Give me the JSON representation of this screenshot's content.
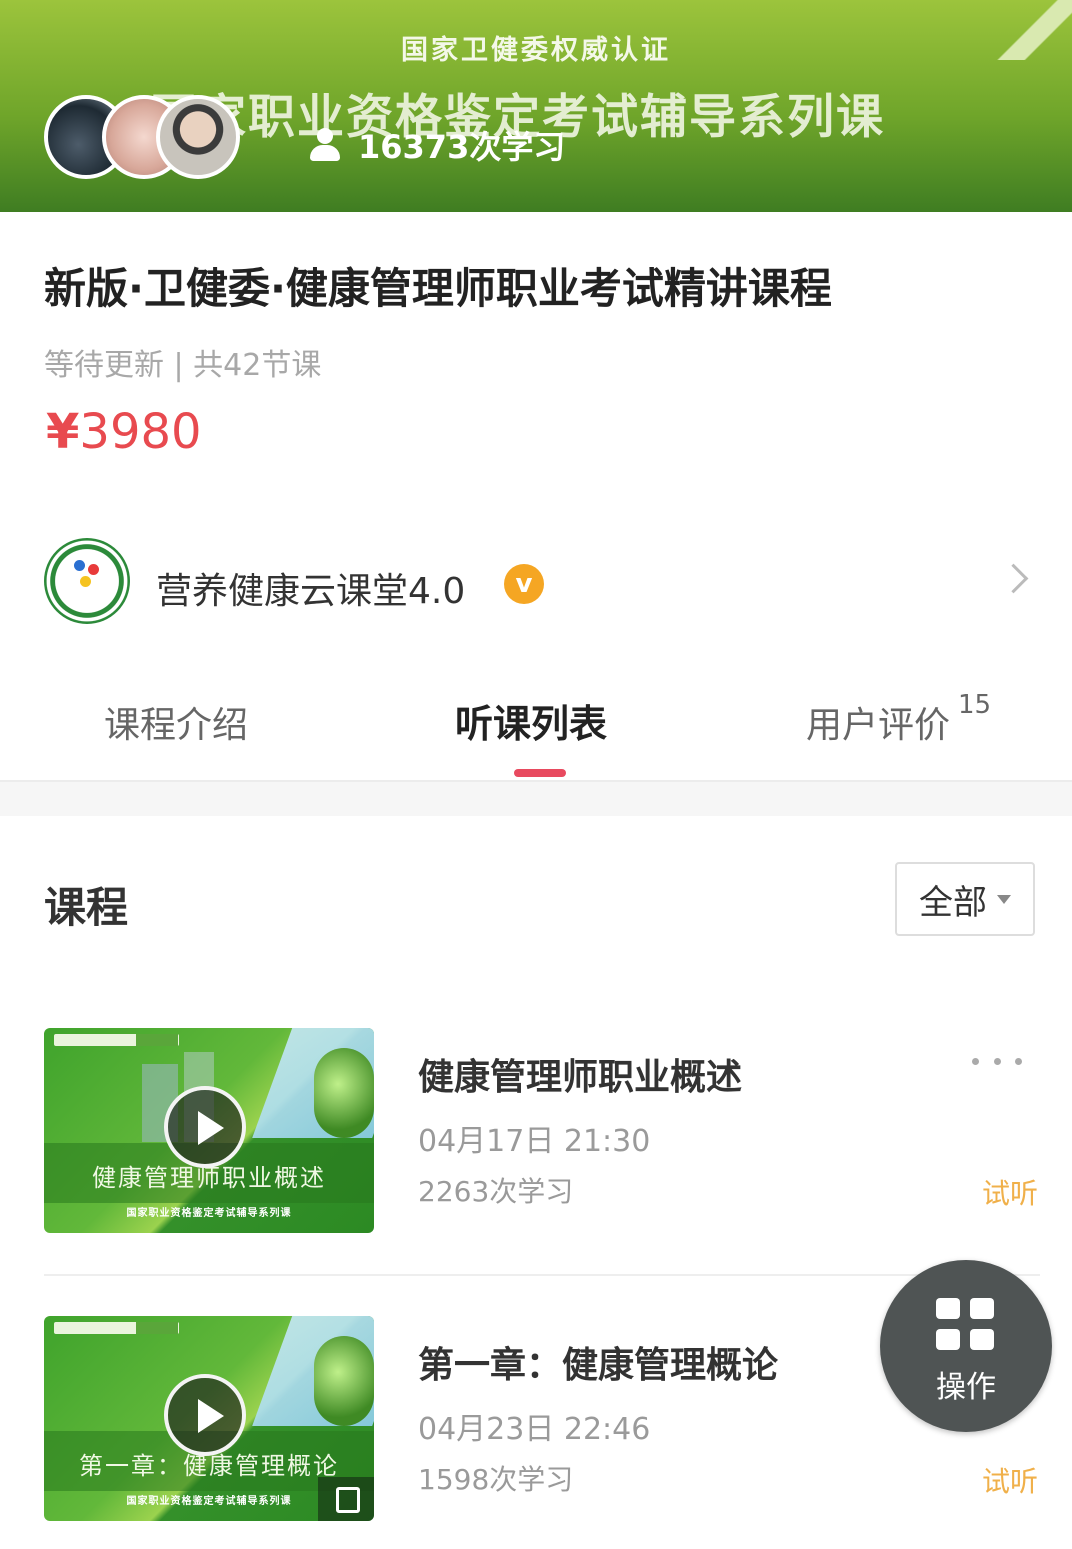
{
  "banner": {
    "top_text": "国家卫健委权威认证",
    "main_text": "国家职业资格鉴定考试辅导系列课",
    "learners": "16373次学习"
  },
  "course": {
    "title": "新版·卫健委·健康管理师职业考试精讲课程",
    "meta": "等待更新 | 共42节课",
    "price_symbol": "¥",
    "price_value": "3980",
    "price_color": "#e84a4f"
  },
  "org": {
    "name": "营养健康云课堂4.0",
    "verified_mark": "v"
  },
  "tabs": [
    {
      "label": "课程介绍"
    },
    {
      "label": "听课列表",
      "active": true
    },
    {
      "label": "用户评价",
      "count": "15"
    }
  ],
  "section": {
    "title": "课程",
    "filter_label": "全部"
  },
  "lessons": [
    {
      "title": "健康管理师职业概述",
      "date": "04月17日 21:30",
      "count": "2263次学习",
      "trial": "试听",
      "thumb_caption": "健康管理师职业概述",
      "thumb_sub": "国家职业资格鉴定考试辅导系列课"
    },
    {
      "title": "第一章：健康管理概论",
      "date": "04月23日 22:46",
      "count": "1598次学习",
      "trial": "试听",
      "thumb_caption": "第一章：健康管理概论",
      "thumb_sub": "国家职业资格鉴定考试辅导系列课"
    }
  ],
  "fab": {
    "label": "操作"
  },
  "colors": {
    "brand_green": "#6fa52a",
    "accent_red": "#e84a5f",
    "trial_orange": "#f0b04a"
  }
}
